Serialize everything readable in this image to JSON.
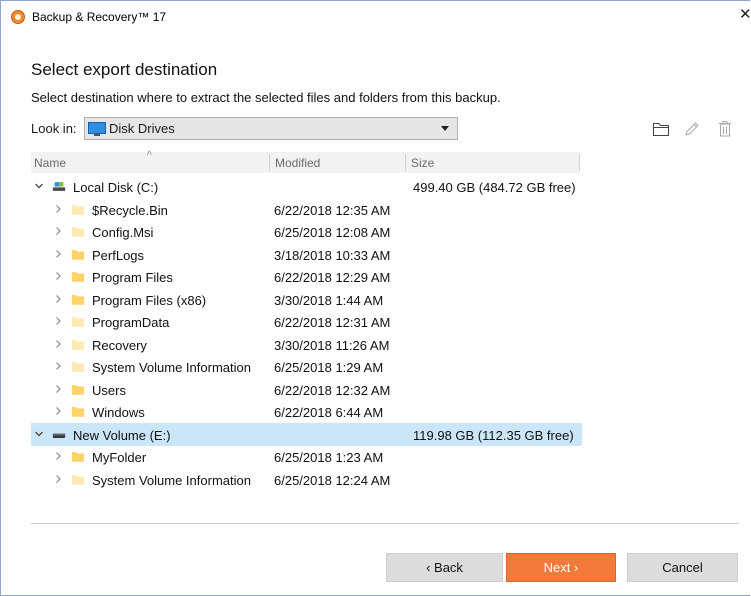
{
  "window": {
    "title": "Backup & Recovery™ 17",
    "close_glyph": "✕"
  },
  "page": {
    "heading": "Select export destination",
    "subheading": "Select destination where to extract the selected files and folders from this backup."
  },
  "look_in": {
    "label": "Look in:",
    "value": "Disk Drives",
    "icon": "disk-drives-icon"
  },
  "toolbar": {
    "icons": [
      "new-folder-icon",
      "rename-pencil-icon",
      "delete-trash-icon"
    ]
  },
  "columns": {
    "name": "Name",
    "modified": "Modified",
    "size": "Size"
  },
  "tree": [
    {
      "name": "Local Disk (C:)",
      "modified": "",
      "size": "499.40 GB (484.72 GB free)",
      "type": "drive-local",
      "expanded": true,
      "level": 0
    },
    {
      "name": "$Recycle.Bin",
      "modified": "6/22/2018 12:35 AM",
      "size": "",
      "type": "folder-hidden",
      "level": 1
    },
    {
      "name": "Config.Msi",
      "modified": "6/25/2018 12:08 AM",
      "size": "",
      "type": "folder-hidden",
      "level": 1
    },
    {
      "name": "PerfLogs",
      "modified": "3/18/2018 10:33 AM",
      "size": "",
      "type": "folder",
      "level": 1
    },
    {
      "name": "Program Files",
      "modified": "6/22/2018 12:29 AM",
      "size": "",
      "type": "folder",
      "level": 1
    },
    {
      "name": "Program Files (x86)",
      "modified": "3/30/2018 1:44 AM",
      "size": "",
      "type": "folder",
      "level": 1
    },
    {
      "name": "ProgramData",
      "modified": "6/22/2018 12:31 AM",
      "size": "",
      "type": "folder-hidden",
      "level": 1
    },
    {
      "name": "Recovery",
      "modified": "3/30/2018 11:26 AM",
      "size": "",
      "type": "folder-hidden",
      "level": 1
    },
    {
      "name": "System Volume Information",
      "modified": "6/25/2018 1:29 AM",
      "size": "",
      "type": "folder-hidden",
      "level": 1
    },
    {
      "name": "Users",
      "modified": "6/22/2018 12:32 AM",
      "size": "",
      "type": "folder",
      "level": 1
    },
    {
      "name": "Windows",
      "modified": "6/22/2018 6:44 AM",
      "size": "",
      "type": "folder",
      "level": 1
    },
    {
      "name": "New Volume (E:)",
      "modified": "",
      "size": "119.98 GB (112.35 GB free)",
      "type": "drive-volume",
      "expanded": true,
      "level": 0,
      "selected": true
    },
    {
      "name": "MyFolder",
      "modified": "6/25/2018 1:23 AM",
      "size": "",
      "type": "folder",
      "level": 1
    },
    {
      "name": "System Volume Information",
      "modified": "6/25/2018 12:24 AM",
      "size": "",
      "type": "folder-hidden",
      "level": 1
    }
  ],
  "buttons": {
    "back": "‹ Back",
    "next": "Next ›",
    "cancel": "Cancel"
  },
  "colors": {
    "accent": "#f47a3c",
    "selection": "#cce6f9",
    "folder": "#fcd36b",
    "folder_hidden": "#fde9b3"
  }
}
